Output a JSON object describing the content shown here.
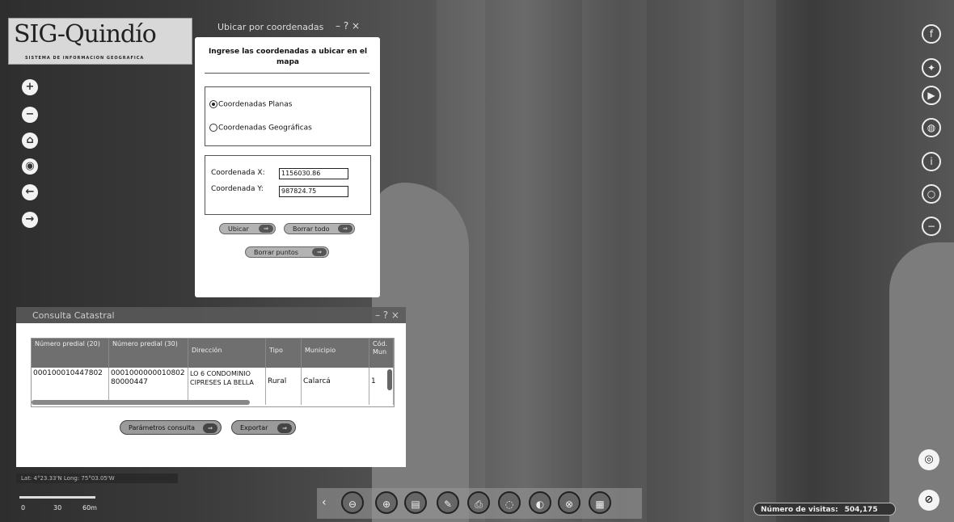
{
  "logo": {
    "title": "SIG-Quindío",
    "subtitle": "SISTEMA DE INFORMACION GEOGRAFICA"
  },
  "nav_icons": [
    "zoom-in-icon",
    "zoom-out-icon",
    "home-icon",
    "locate-icon",
    "back-icon",
    "forward-icon"
  ],
  "social_icons": [
    "facebook-icon",
    "twitter-icon",
    "youtube-icon",
    "globe-icon",
    "info-icon",
    "circle-icon",
    "minus-circle-icon"
  ],
  "coord_dialog": {
    "title": "Ubicar por coordenadas",
    "controls": "– ? ×",
    "heading": "Ingrese las coordenadas a ubicar en el mapa",
    "radio_options": [
      {
        "label": "Coordenadas Planas",
        "selected": true
      },
      {
        "label": "Coordenadas Geográficas",
        "selected": false
      }
    ],
    "x_label": "Coordenada X:",
    "x_value": "1156030.86",
    "y_label": "Coordenada Y:",
    "y_value": "987824.75",
    "ubicar_button": "Ubicar",
    "borrar_todo_button": "Borrar todo",
    "borrar_puntos_button": "Borrar puntos"
  },
  "catastro": {
    "title": "Consulta Catastral",
    "controls": "– ? ×",
    "columns": [
      "Número predial (20)",
      "Número predial (30)",
      "Dirección",
      "Tipo",
      "Municipio",
      "Cód. Mun"
    ],
    "rows": [
      [
        "000100010447802",
        "000100000001080280000447",
        "LO 6 CONDOMINIO CIPRESES LA BELLA",
        "Rural",
        "Calarcá",
        "1"
      ]
    ],
    "params_button": "Parámetros consulta",
    "export_button": "Exportar"
  },
  "status": {
    "coords_text": "Lat: 4°23.33'N Long: 75°03.05'W",
    "scale_0": "0",
    "scale_30": "30",
    "scale_60": "60m"
  },
  "toolbar": {
    "arrow": "‹",
    "tools": [
      "measure-icon",
      "layers-icon",
      "map-icon",
      "draw-icon",
      "print-icon",
      "identify-icon",
      "buffer-icon",
      "coordinates-icon",
      "report-icon"
    ]
  },
  "visits": {
    "label": "Número de visitas:",
    "count": "504,175"
  }
}
